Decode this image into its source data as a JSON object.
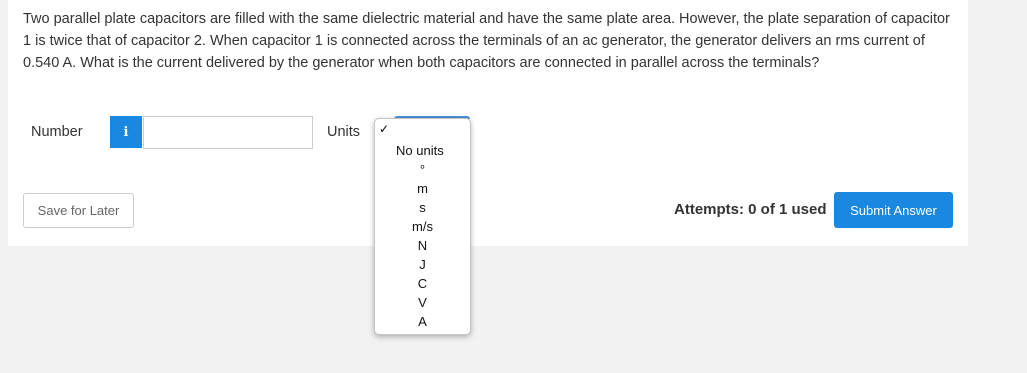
{
  "question": {
    "text": "Two parallel plate capacitors are filled with the same dielectric material and have the same plate area. However, the plate separation of capacitor 1 is twice that of capacitor 2. When capacitor 1 is connected across the terminals of an ac generator, the generator delivers an rms current of 0.540 A. What is the current delivered by the generator when both capacitors are connected in parallel across the terminals?"
  },
  "answer": {
    "number_label": "Number",
    "info_icon_glyph": "i",
    "number_value": "",
    "units_label": "Units",
    "units_dropdown": {
      "checkmark": "✓",
      "selected": "No units",
      "options": [
        "No units",
        "°",
        "m",
        "s",
        "m/s",
        "N",
        "J",
        "C",
        "V",
        "A"
      ]
    }
  },
  "footer": {
    "save_label": "Save for Later",
    "attempts_text": "Attempts: 0 of 1 used",
    "submit_label": "Submit Answer"
  },
  "colors": {
    "accent": "#1a88e0",
    "page_background": "#f2f2f2",
    "card_background": "#ffffff",
    "text": "#333333"
  }
}
